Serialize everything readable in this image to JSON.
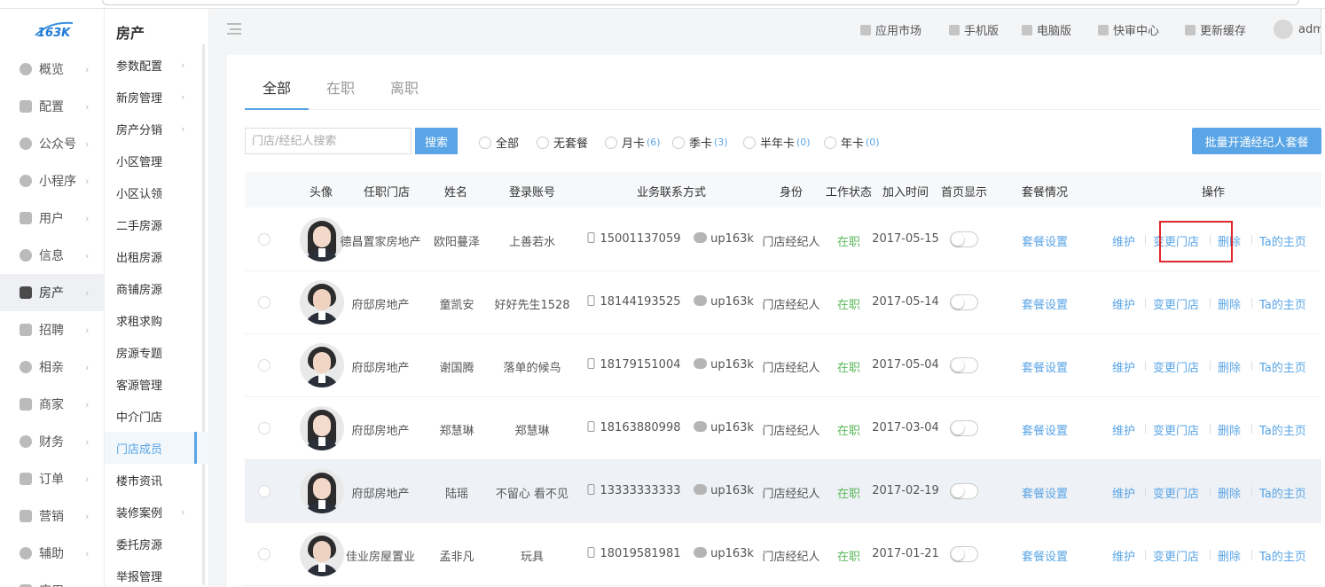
{
  "brand": {
    "logo_text": "163K"
  },
  "sidebar": {
    "items": [
      {
        "label": "概览",
        "icon": "gauge-icon"
      },
      {
        "label": "配置",
        "icon": "grid-icon"
      },
      {
        "label": "公众号",
        "icon": "wechat-icon"
      },
      {
        "label": "小程序",
        "icon": "miniprogram-icon"
      },
      {
        "label": "用户",
        "icon": "user-icon"
      },
      {
        "label": "信息",
        "icon": "message-icon"
      },
      {
        "label": "房产",
        "icon": "building-icon"
      },
      {
        "label": "招聘",
        "icon": "job-icon"
      },
      {
        "label": "相亲",
        "icon": "heart-icon"
      },
      {
        "label": "商家",
        "icon": "shop-icon"
      },
      {
        "label": "财务",
        "icon": "finance-icon"
      },
      {
        "label": "订单",
        "icon": "order-icon"
      },
      {
        "label": "营销",
        "icon": "marketing-icon"
      },
      {
        "label": "辅助",
        "icon": "helper-icon"
      },
      {
        "label": "应用",
        "icon": "app-icon"
      }
    ]
  },
  "subnav": {
    "title": "房产",
    "items": [
      {
        "label": "参数配置",
        "chevron": true
      },
      {
        "label": "新房管理",
        "chevron": true
      },
      {
        "label": "房产分销",
        "chevron": true
      },
      {
        "label": "小区管理",
        "chevron": false
      },
      {
        "label": "小区认领",
        "chevron": false
      },
      {
        "label": "二手房源",
        "chevron": false
      },
      {
        "label": "出租房源",
        "chevron": false
      },
      {
        "label": "商铺房源",
        "chevron": false
      },
      {
        "label": "求租求购",
        "chevron": false
      },
      {
        "label": "房源专题",
        "chevron": false
      },
      {
        "label": "客源管理",
        "chevron": false
      },
      {
        "label": "中介门店",
        "chevron": false
      },
      {
        "label": "门店成员",
        "chevron": false
      },
      {
        "label": "楼市资讯",
        "chevron": false
      },
      {
        "label": "装修案例",
        "chevron": true
      },
      {
        "label": "委托房源",
        "chevron": false
      },
      {
        "label": "举报管理",
        "chevron": false
      }
    ]
  },
  "header": {
    "links": [
      "应用市场",
      "手机版",
      "电脑版",
      "快审中心",
      "更新缓存"
    ],
    "user": "admin"
  },
  "tabs": [
    "全部",
    "在职",
    "离职"
  ],
  "search": {
    "placeholder": "门店/经纪人搜索",
    "button": "搜索"
  },
  "filters": [
    {
      "label": "全部",
      "count": ""
    },
    {
      "label": "无套餐",
      "count": ""
    },
    {
      "label": "月卡",
      "count": "(6)"
    },
    {
      "label": "季卡",
      "count": "(3)"
    },
    {
      "label": "半年卡",
      "count": "(0)"
    },
    {
      "label": "年卡",
      "count": "(0)"
    }
  ],
  "bulk_button": "批量开通经纪人套餐",
  "table": {
    "headers": [
      "头像",
      "任职门店",
      "姓名",
      "登录账号",
      "业务联系方式",
      "身份",
      "工作状态",
      "加入时间",
      "首页显示",
      "套餐情况",
      "操作"
    ],
    "rows": [
      {
        "store": "德昌置家房地产",
        "name": "欧阳蔓泽",
        "account": "上善若水",
        "phone": "15001137059",
        "wechat": "up163k",
        "role": "门店经纪人",
        "status": "在职",
        "joined": "2017-05-15",
        "package": "套餐设置"
      },
      {
        "store": "府邸房地产",
        "name": "童凯安",
        "account": "好好先生1528",
        "phone": "18144193525",
        "wechat": "up163k",
        "role": "门店经纪人",
        "status": "在职",
        "joined": "2017-05-14",
        "package": "套餐设置"
      },
      {
        "store": "府邸房地产",
        "name": "谢国腾",
        "account": "落单的候鸟",
        "phone": "18179151004",
        "wechat": "up163k",
        "role": "门店经纪人",
        "status": "在职",
        "joined": "2017-05-04",
        "package": "套餐设置"
      },
      {
        "store": "府邸房地产",
        "name": "郑慧琳",
        "account": "郑慧琳",
        "phone": "18163880998",
        "wechat": "up163k",
        "role": "门店经纪人",
        "status": "在职",
        "joined": "2017-03-04",
        "package": "套餐设置"
      },
      {
        "store": "府邸房地产",
        "name": "陆瑶",
        "account": "不留心 看不见",
        "phone": "13333333333",
        "wechat": "up163k",
        "role": "门店经纪人",
        "status": "在职",
        "joined": "2017-02-19",
        "package": "套餐设置"
      },
      {
        "store": "佳业房屋置业",
        "name": "孟非凡",
        "account": "玩具",
        "phone": "18019581981",
        "wechat": "up163k",
        "role": "门店经纪人",
        "status": "在职",
        "joined": "2017-01-21",
        "package": "套餐设置"
      }
    ],
    "actions": [
      "维护",
      "变更门店",
      "删除",
      "Ta的主页"
    ]
  },
  "colors": {
    "accent": "#5aa5e6",
    "status_on": "#5cb85c",
    "highlight_box": "#e0272a"
  }
}
